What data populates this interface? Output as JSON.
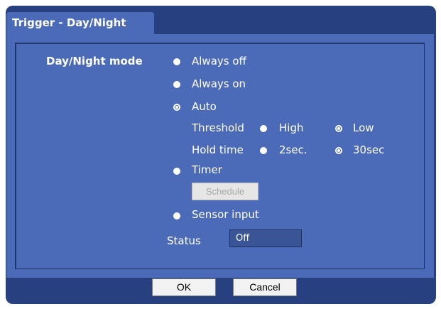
{
  "tab": {
    "title": "Trigger - Day/Night"
  },
  "day_night": {
    "label": "Day/Night mode",
    "options": [
      {
        "label": "Always off",
        "selected": false
      },
      {
        "label": "Always on",
        "selected": false
      },
      {
        "label": "Auto",
        "selected": true
      },
      {
        "label": "Timer",
        "selected": false
      },
      {
        "label": "Sensor input",
        "selected": false
      }
    ],
    "threshold": {
      "label": "Threshold",
      "options": [
        {
          "label": "High",
          "selected": false
        },
        {
          "label": "Low",
          "selected": true
        }
      ]
    },
    "hold_time": {
      "label": "Hold time",
      "options": [
        {
          "label": "2sec.",
          "selected": false
        },
        {
          "label": "30sec",
          "selected": true
        }
      ]
    },
    "schedule_button": "Schedule",
    "status": {
      "label": "Status",
      "value": "Off"
    }
  },
  "buttons": {
    "ok": "OK",
    "cancel": "Cancel"
  },
  "colors": {
    "frame": "#27407f",
    "panel": "#4b6bb8",
    "text": "#ffffff"
  }
}
